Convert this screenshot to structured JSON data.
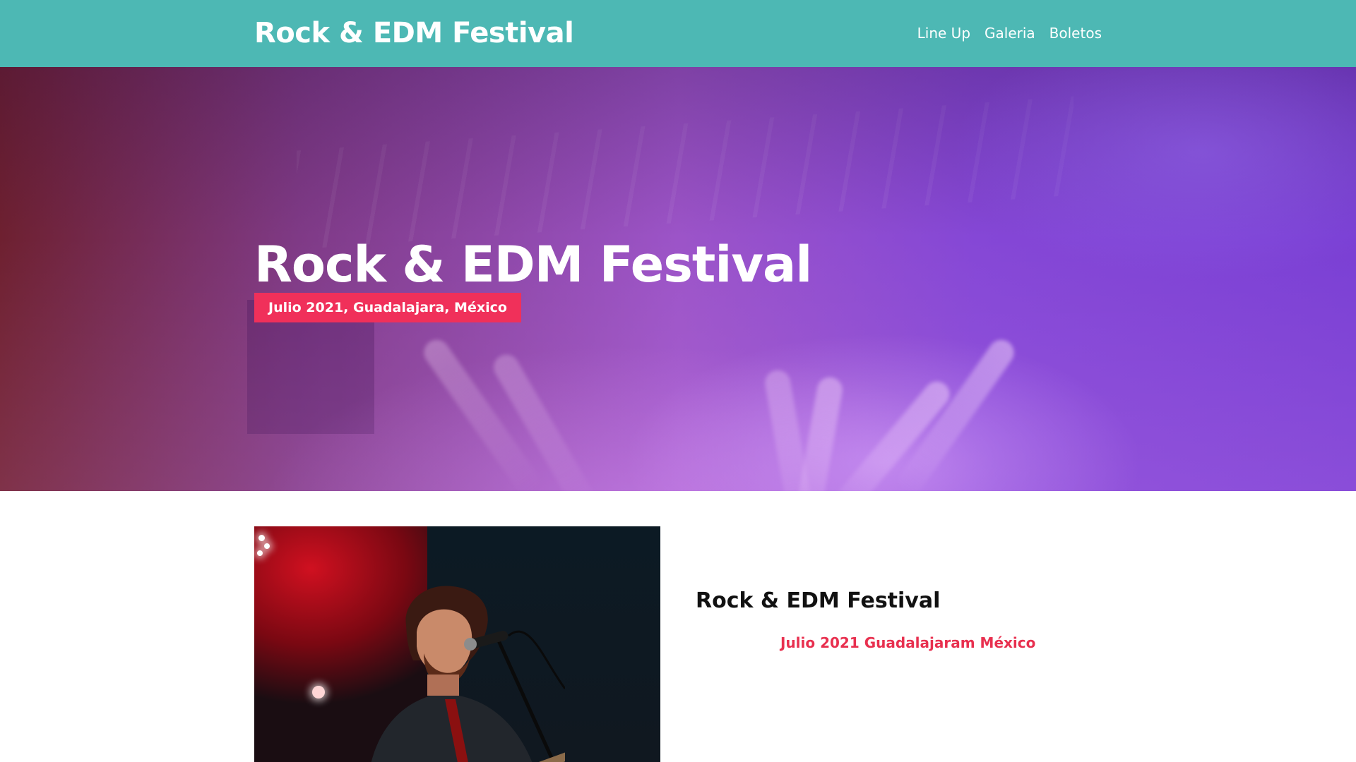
{
  "navbar": {
    "logo": "Rock & EDM Festival",
    "links": [
      {
        "label": "Line Up"
      },
      {
        "label": "Galeria"
      },
      {
        "label": "Boletos"
      }
    ],
    "background_color": "#4db8b4"
  },
  "hero": {
    "title": "Rock & EDM Festival",
    "badge": "Julio 2021, Guadalajara, México",
    "badge_color": "#f0305a"
  },
  "content": {
    "image_icon": "concert-singer-photo",
    "title": "Rock & EDM Festival",
    "subtitle": "Julio 2021 Guadalajaram México",
    "subtitle_color": "#e8304f"
  }
}
